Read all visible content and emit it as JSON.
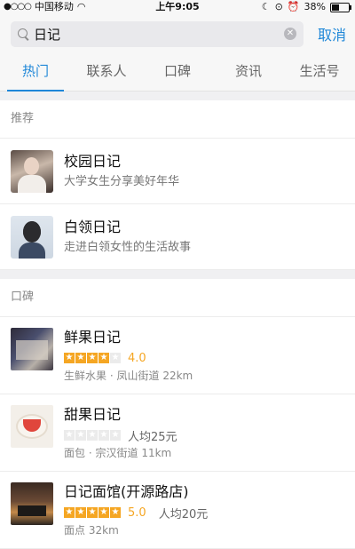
{
  "status_bar": {
    "signal": "●○○○",
    "carrier": "中国移动",
    "wifi_glyph": "◠",
    "time": "上午9:05",
    "icons": [
      "moon-icon",
      "rotation-lock-icon",
      "alarm-icon"
    ],
    "battery_percent": "38%",
    "battery_level": 0.38
  },
  "search": {
    "query": "日记",
    "cancel_label": "取消"
  },
  "tabs": [
    {
      "label": "热门",
      "active": true
    },
    {
      "label": "联系人",
      "active": false
    },
    {
      "label": "口碑",
      "active": false
    },
    {
      "label": "资讯",
      "active": false
    },
    {
      "label": "生活号",
      "active": false
    }
  ],
  "recommend": {
    "header": "推荐",
    "items": [
      {
        "title": "校园日记",
        "subtitle": "大学女生分享美好年华"
      },
      {
        "title": "白领日记",
        "subtitle": "走进白领女性的生活故事"
      }
    ]
  },
  "koubei": {
    "header": "口碑",
    "items": [
      {
        "title": "鲜果日记",
        "stars": 4,
        "score": "4.0",
        "avg_price": "",
        "category": "生鲜水果",
        "street": "凤山街道",
        "distance": "22km"
      },
      {
        "title": "甜果日记",
        "stars": 0,
        "score": "",
        "avg_price": "人均25元",
        "category": "面包",
        "street": "宗汉街道",
        "distance": "11km"
      },
      {
        "title": "日记面馆(开源路店)",
        "stars": 5,
        "score": "5.0",
        "avg_price": "人均20元",
        "category": "面点",
        "street": "",
        "distance": "32km"
      }
    ]
  },
  "colors": {
    "accent": "#1f87d8",
    "star": "#f5a623"
  }
}
